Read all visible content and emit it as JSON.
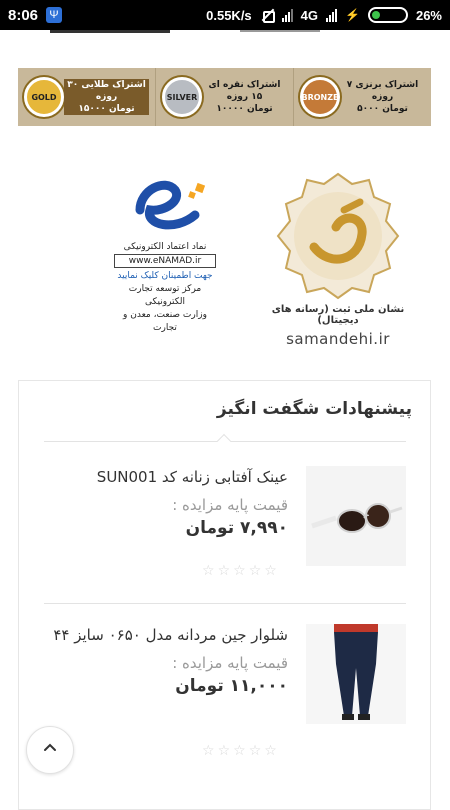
{
  "status_bar": {
    "time": "8:06",
    "net_speed": "0.55K/s",
    "network": "4G",
    "battery": "26%",
    "battery_level": 0.26
  },
  "banner": {
    "plans": [
      {
        "line1": "اشتراک برنزی ۷ روزه",
        "line2": "۵۰۰۰ تومان",
        "medal": "BRONZE"
      },
      {
        "line1": "اشتراک نقره ای ۱۵ روزه",
        "line2": "۱۰۰۰۰ تومان",
        "medal": "SILVER"
      },
      {
        "line1": "اشتراک طلایی ۳۰ روزه",
        "line2": "۱۵۰۰۰ تومان",
        "medal": "GOLD"
      }
    ]
  },
  "enamad": {
    "label": "نماد اعتماد الکترونیکی",
    "url": "www.eNAMAD.ir",
    "click_hint": "جهت اطمینان کلیک نمایید",
    "org1": "مرکز توسعه تجارت الکترونیکی",
    "org2": "وزارت صنعت، معدن و تجارت"
  },
  "samandehi": {
    "caption": "نشان ملی ثبت (رسانه های دیجیتال)",
    "site": "samandehi.ir"
  },
  "offers": {
    "title": "پیشنهادات شگفت انگیز",
    "products": [
      {
        "name": "عینک آفتابی زنانه کد SUN001",
        "base_label": "قیمت پایه مزایده :",
        "price": "۷,۹۹۰ تومان",
        "image": "sunglasses-image"
      },
      {
        "name": "شلوار جین مردانه مدل ۰۶۵۰ سایز ۴۴",
        "base_label": "قیمت پایه مزایده :",
        "price": "۱۱,۰۰۰ تومان",
        "image": "jeans-image"
      }
    ]
  },
  "back_to_top": {
    "icon": "chevron-up-icon",
    "glyph": "⌃"
  }
}
